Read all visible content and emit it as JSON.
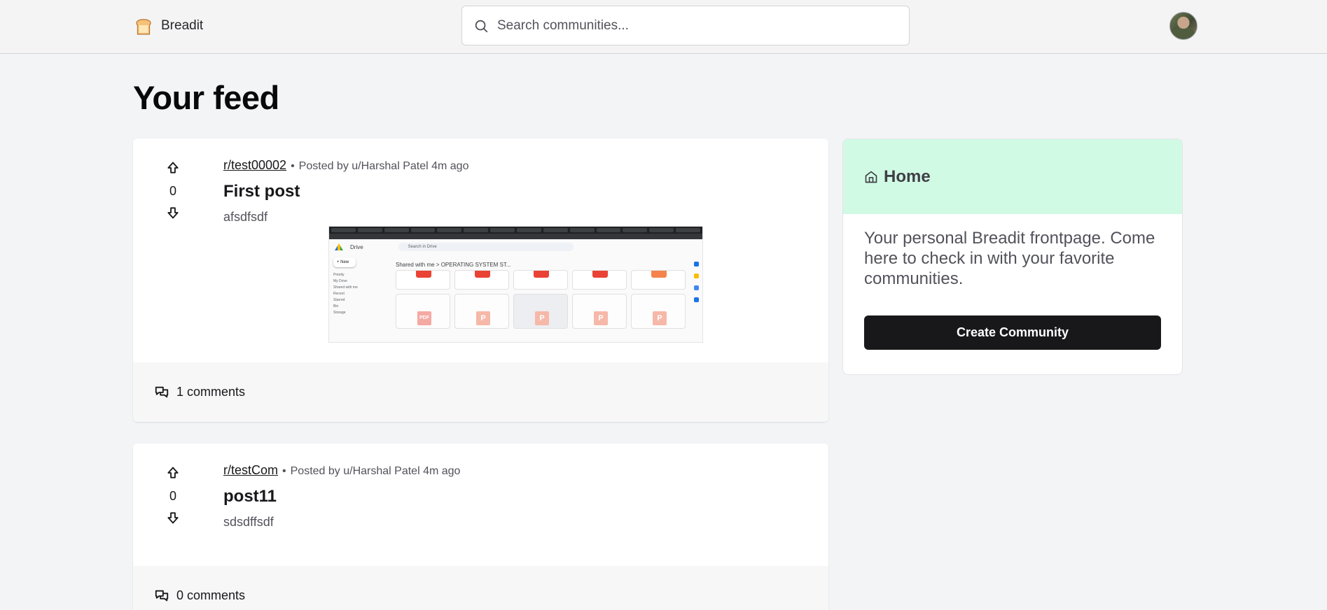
{
  "app": {
    "name": "Breadit"
  },
  "search": {
    "placeholder": "Search communities..."
  },
  "feed": {
    "title": "Your feed"
  },
  "posts": [
    {
      "subreddit": "r/test00002",
      "posted_by": "Posted by u/Harshal Patel 4m ago",
      "title": "First post",
      "body": "afsdfsdf",
      "votes": "0",
      "comments": "1 comments",
      "embedded_screenshot": {
        "app": "Drive",
        "search": "Search in Drive",
        "crumb": "Shared with me  >  OPERATING SYSTEM ST...",
        "new": "New",
        "nav": [
          "Priority",
          "My Drive",
          "Shared with me",
          "Recent",
          "Starred",
          "Bin",
          "Storage"
        ]
      }
    },
    {
      "subreddit": "r/testCom",
      "posted_by": "Posted by u/Harshal Patel 4m ago",
      "title": "post11",
      "body": "sdsdffsdf",
      "votes": "0",
      "comments": "0 comments"
    }
  ],
  "sidebar": {
    "title": "Home",
    "description": "Your personal Breadit frontpage. Come here to check in with your favorite communities.",
    "button": "Create Community"
  },
  "colors": {
    "sidebar_header": "#d1fae5",
    "button": "#18181b",
    "page_bg": "#f3f4f6"
  },
  "icons": {
    "logo": "bread-icon",
    "search": "search-icon",
    "upvote": "arrow-up-icon",
    "downvote": "arrow-down-icon",
    "comments": "message-squares-icon",
    "home": "home-icon"
  }
}
